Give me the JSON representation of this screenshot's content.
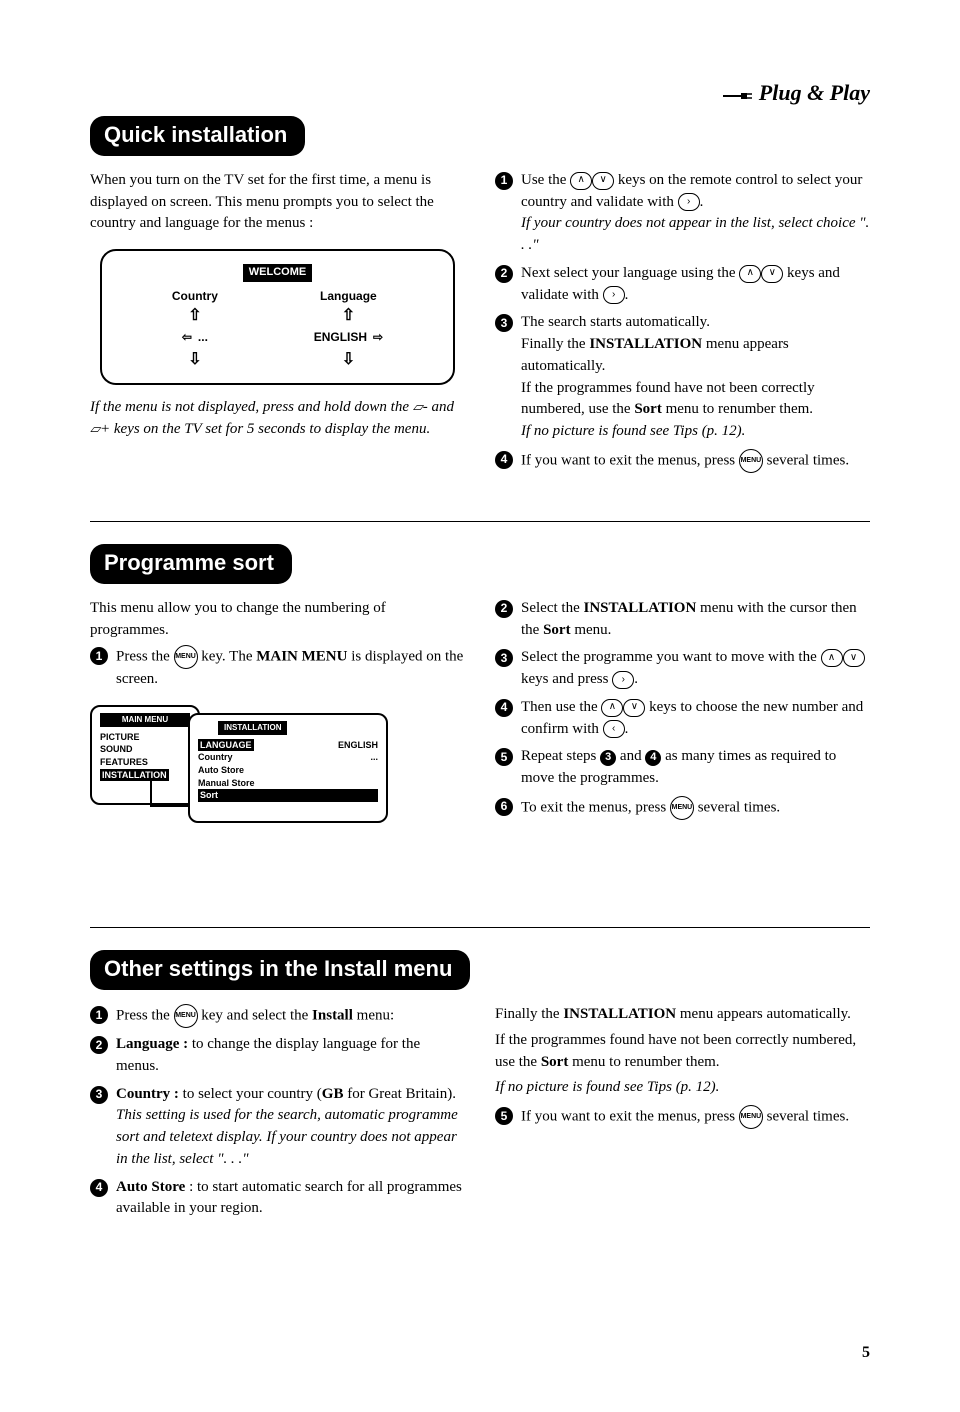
{
  "header": {
    "logo": "Plug & Play"
  },
  "section1": {
    "title": "Quick installation",
    "intro": "When you turn on the TV set for the first time, a menu is displayed on screen. This menu prompts you to select the country and language for the menus :",
    "welcome": {
      "header": "WELCOME",
      "col1_label": "Country",
      "col1_value": "...",
      "col2_label": "Language",
      "col2_value": "ENGLISH"
    },
    "note": "If the menu is not displayed, press and hold down the ▱- and ▱+ keys on the TV set for 5 seconds to display the menu.",
    "steps": [
      {
        "n": "1",
        "t1": "Use the ",
        "t2": " keys on the remote control to select your country and validate with ",
        "t3": ".",
        "italic": "If your country does not appear in the list, select choice \". . .\""
      },
      {
        "n": "2",
        "t1": "Next select your language using the ",
        "t2": " keys and validate with ",
        "t3": "."
      },
      {
        "n": "3",
        "t1": "The search starts automatically.",
        "t2": "Finally the ",
        "bold": "INSTALLATION",
        "t3": " menu appears automatically.",
        "t4": "If the programmes found have not been correctly numbered, use the ",
        "bold2": "Sort",
        "t5": " menu to renumber them.",
        "italic": "If no picture is found see Tips (p. 12)."
      },
      {
        "n": "4",
        "t1": "If you want to exit the menus, press ",
        "t2": " several times."
      }
    ]
  },
  "section2": {
    "title": "Programme sort",
    "intro": "This menu allow you to change the numbering of programmes.",
    "step1_a": "Press the ",
    "step1_b": " key. The ",
    "step1_bold": "MAIN MENU",
    "step1_c": " is displayed on the screen.",
    "menu_left": {
      "header": "MAIN MENU",
      "items": [
        "PICTURE",
        "SOUND",
        "FEATURES"
      ],
      "hl": "INSTALLATION"
    },
    "menu_right": {
      "header": "INSTALLATION",
      "rows": [
        {
          "l": "LANGUAGE",
          "r": "ENGLISH",
          "hl_l": true
        },
        {
          "l": "Country",
          "r": "..."
        },
        {
          "l": "Auto Store",
          "r": ""
        },
        {
          "l": "Manual Store",
          "r": ""
        }
      ],
      "sort": "Sort"
    },
    "steps_right": [
      {
        "n": "2",
        "t1": "Select the ",
        "b1": "INSTALLATION",
        "t2": " menu with the cursor then the ",
        "b2": "Sort",
        "t3": " menu."
      },
      {
        "n": "3",
        "t1": "Select the programme you want to move with the ",
        "t2": " keys and press ",
        "t3": "."
      },
      {
        "n": "4",
        "t1": "Then use the ",
        "t2": " keys to choose the new number and confirm with ",
        "t3": "."
      },
      {
        "n": "5",
        "t1": "Repeat steps ",
        "t2": " and ",
        "t3": "  as many times as required to move the programmes."
      },
      {
        "n": "6",
        "t1": "To exit the menus, press ",
        "t2": " several times."
      }
    ]
  },
  "section3": {
    "title": "Other settings in the Install menu",
    "left_steps": [
      {
        "n": "1",
        "t1": "Press the ",
        "t2": " key and select the ",
        "b": "Install",
        "t3": " menu:"
      },
      {
        "n": "2",
        "b": "Language :",
        "t": " to change the display language for the menus."
      },
      {
        "n": "3",
        "b": "Country :",
        "t": " to select your country (",
        "b2": "GB",
        "t2": " for Great Britain).",
        "italic": "This setting is used for the search, automatic programme sort and teletext display. If your country does not appear in the list, select \". . .\""
      },
      {
        "n": "4",
        "b": "Auto Store",
        "t": " : to start automatic search for all programmes available in your region."
      }
    ],
    "right_p1a": "Finally the ",
    "right_p1_bold": "INSTALLATION",
    "right_p1b": " menu appears automatically.",
    "right_p2a": "If the programmes found have not been correctly numbered, use the ",
    "right_p2_bold": "Sort",
    "right_p2b": " menu to renumber them.",
    "right_italic": "If no picture is found see Tips (p. 12).",
    "step5_a": "If you want to exit the menus, press ",
    "step5_b": " several times."
  },
  "page_number": "5",
  "icons": {
    "up": "∧",
    "down": "∨",
    "right": "›",
    "left": "‹",
    "menu": "MENU"
  }
}
